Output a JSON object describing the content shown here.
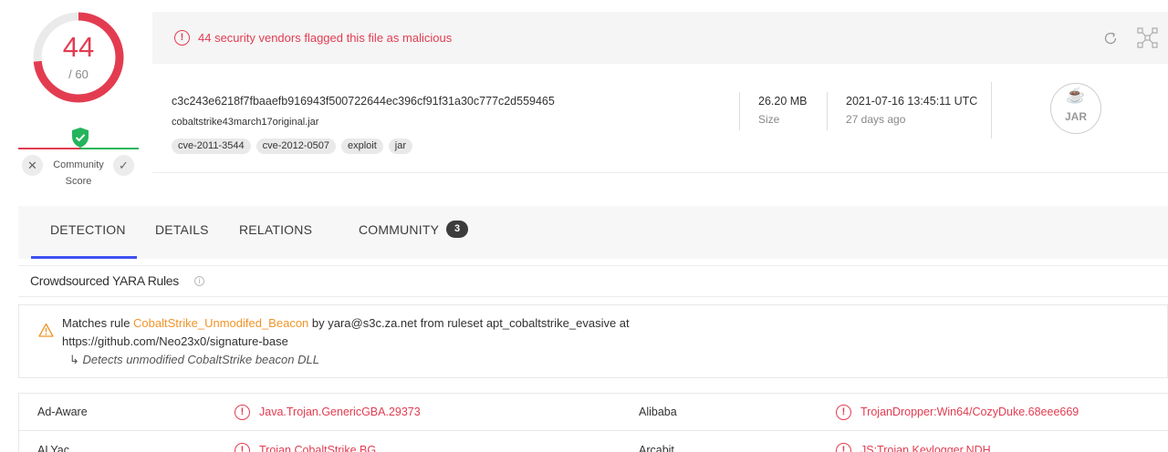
{
  "score": {
    "detections": "44",
    "total": "/ 60",
    "fraction": 0.7333
  },
  "community": {
    "label": "Community Score"
  },
  "alert": {
    "text": "44 security vendors flagged this file as malicious"
  },
  "file": {
    "hash": "c3c243e6218f7fbaaefb916943f500722644ec396cf91f31a30c777c2d559465",
    "name": "cobaltstrike43march17original.jar",
    "tags": [
      "cve-2011-3544",
      "cve-2012-0507",
      "exploit",
      "jar"
    ],
    "size_value": "26.20 MB",
    "size_label": "Size",
    "date_value": "2021-07-16 13:45:11 UTC",
    "date_ago": "27 days ago",
    "type_label": "JAR"
  },
  "tabs": {
    "detection": "DETECTION",
    "details": "DETAILS",
    "relations": "RELATIONS",
    "community": "COMMUNITY",
    "community_count": "3"
  },
  "yara": {
    "title": "Crowdsourced YARA Rules",
    "prefix": "Matches rule ",
    "rule": "CobaltStrike_Unmodifed_Beacon",
    "suffix": " by yara@s3c.za.net from ruleset apt_cobaltstrike_evasive at",
    "url": "https://github.com/Neo23x0/signature-base",
    "description": "Detects unmodified CobaltStrike beacon DLL"
  },
  "detections": [
    {
      "vendor": "Ad-Aware",
      "result": "Java.Trojan.GenericGBA.29373"
    },
    {
      "vendor": "Alibaba",
      "result": "TrojanDropper:Win64/CozyDuke.68eee669"
    },
    {
      "vendor": "ALYac",
      "result": "Trojan.CobaltStrike.BG"
    },
    {
      "vendor": "Arcabit",
      "result": "JS:Trojan.Keylogger.NDH"
    }
  ],
  "colors": {
    "malicious": "#e33c51",
    "accent": "#3f51f0",
    "yara_rule": "#f0952a",
    "clean": "#24b45b"
  }
}
